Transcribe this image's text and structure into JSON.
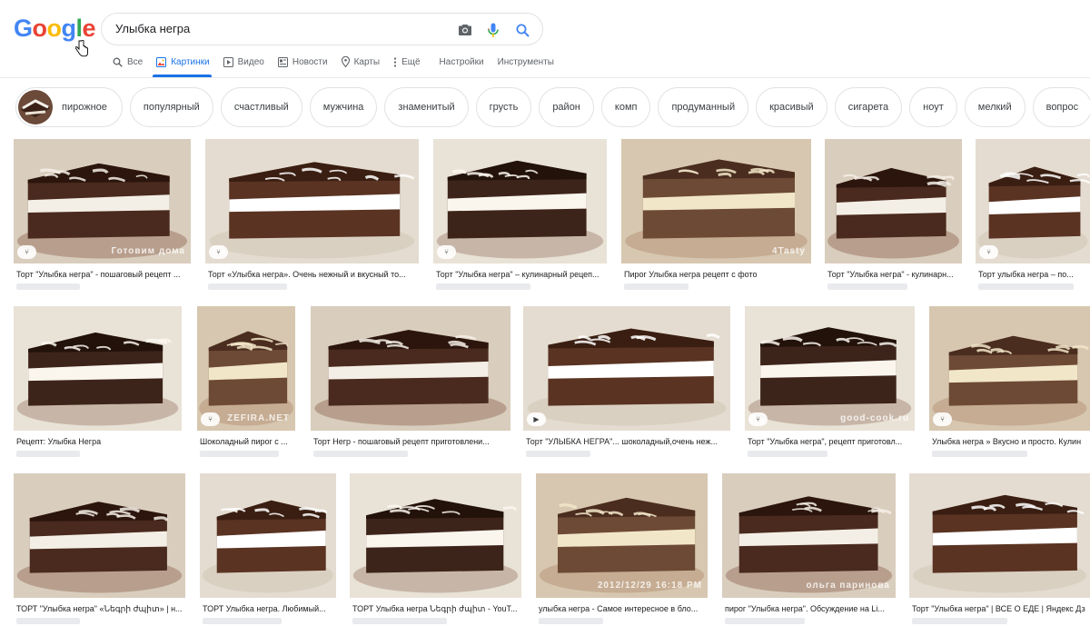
{
  "header": {
    "logo_letters": [
      {
        "ch": "G",
        "color": "#4285F4"
      },
      {
        "ch": "o",
        "color": "#EA4335"
      },
      {
        "ch": "o",
        "color": "#FBBC05"
      },
      {
        "ch": "g",
        "color": "#4285F4"
      },
      {
        "ch": "l",
        "color": "#34A853"
      },
      {
        "ch": "e",
        "color": "#EA4335"
      }
    ],
    "query": "Улыбка негра",
    "icons": {
      "camera": "camera-icon",
      "mic": "microphone-icon",
      "search": "search-icon"
    }
  },
  "tabs": [
    {
      "label": "Все",
      "icon": "search-icon",
      "active": false
    },
    {
      "label": "Картинки",
      "icon": "image-icon",
      "active": true
    },
    {
      "label": "Видео",
      "icon": "video-icon",
      "active": false
    },
    {
      "label": "Новости",
      "icon": "news-icon",
      "active": false
    },
    {
      "label": "Карты",
      "icon": "map-pin-icon",
      "active": false
    },
    {
      "label": "Ещё",
      "icon": "more-vert-icon",
      "active": false
    },
    {
      "label": "Настройки",
      "icon": "",
      "active": false
    },
    {
      "label": "Инструменты",
      "icon": "",
      "active": false
    }
  ],
  "chips": [
    "пирожное",
    "популярный",
    "счастливый",
    "мужчина",
    "знаменитый",
    "грусть",
    "район",
    "комп",
    "продуманный",
    "красивый",
    "сигарета",
    "ноут",
    "мелкий",
    "вопрос"
  ],
  "results": [
    [
      {
        "caption": "Торт \"Улыбка негра\" - пошаговый рецепт ...",
        "badge": "recipe-icon",
        "watermark": "Готовим дома"
      },
      {
        "caption": "Торт «Улыбка негра». Очень нежный и вкусный то...",
        "badge": "recipe-icon",
        "watermark": ""
      },
      {
        "caption": "Торт \"Улыбка негра\" – кулинарный рецеп...",
        "badge": "recipe-icon",
        "watermark": ""
      },
      {
        "caption": "Пирог Улыбка негра рецепт с фото",
        "badge": "",
        "watermark": "4Tasty"
      },
      {
        "caption": "Торт \"Улыбка негра\" - кулинарн...",
        "badge": "",
        "watermark": ""
      },
      {
        "caption": "Торт улыбка негра – по...",
        "badge": "recipe-icon",
        "watermark": ""
      }
    ],
    [
      {
        "caption": "Рецепт: Улыбка Негра",
        "badge": "",
        "watermark": ""
      },
      {
        "caption": "Шоколадный пирог с ...",
        "badge": "recipe-icon",
        "watermark": "ZEFIRA.NET"
      },
      {
        "caption": "Торт Негр - пошаговый рецепт приготовлени...",
        "badge": "",
        "watermark": ""
      },
      {
        "caption": "Торт \"УЛЫБКА НЕГРА\"... шоколадный,очень неж...",
        "badge": "play-icon",
        "watermark": ""
      },
      {
        "caption": "Торт \"Улыбка негра\", рецепт приготовл...",
        "badge": "recipe-icon",
        "watermark": "good-cook.ru"
      },
      {
        "caption": "Улыбка негра » Вкусно и просто. Кулин",
        "badge": "recipe-icon",
        "watermark": ""
      }
    ],
    [
      {
        "caption": "ТОРТ \"Улыбка негра\" «Նեգրի ժպիտ» | н...",
        "badge": "",
        "watermark": ""
      },
      {
        "caption": "ТОРТ Улыбка негра. Любимый...",
        "badge": "",
        "watermark": ""
      },
      {
        "caption": "ТОРТ Улыбка негра Նեգրի ժպիտ - YouT...",
        "badge": "",
        "watermark": ""
      },
      {
        "caption": "улыбка негра - Самое интересное в бло...",
        "badge": "",
        "watermark": "2012/12/29 16:18 PM"
      },
      {
        "caption": "пирог \"Улыбка негра\". Обсуждение на Li...",
        "badge": "",
        "watermark": "ольга паринова"
      },
      {
        "caption": "Торт \"Улыбка негра\" | ВСЕ О ЕДЕ | Яндекс Дз",
        "badge": "",
        "watermark": ""
      }
    ]
  ],
  "colors": {
    "accent": "#1a73e8",
    "chip_border": "#dfe1e5",
    "text_secondary": "#5f6368"
  }
}
